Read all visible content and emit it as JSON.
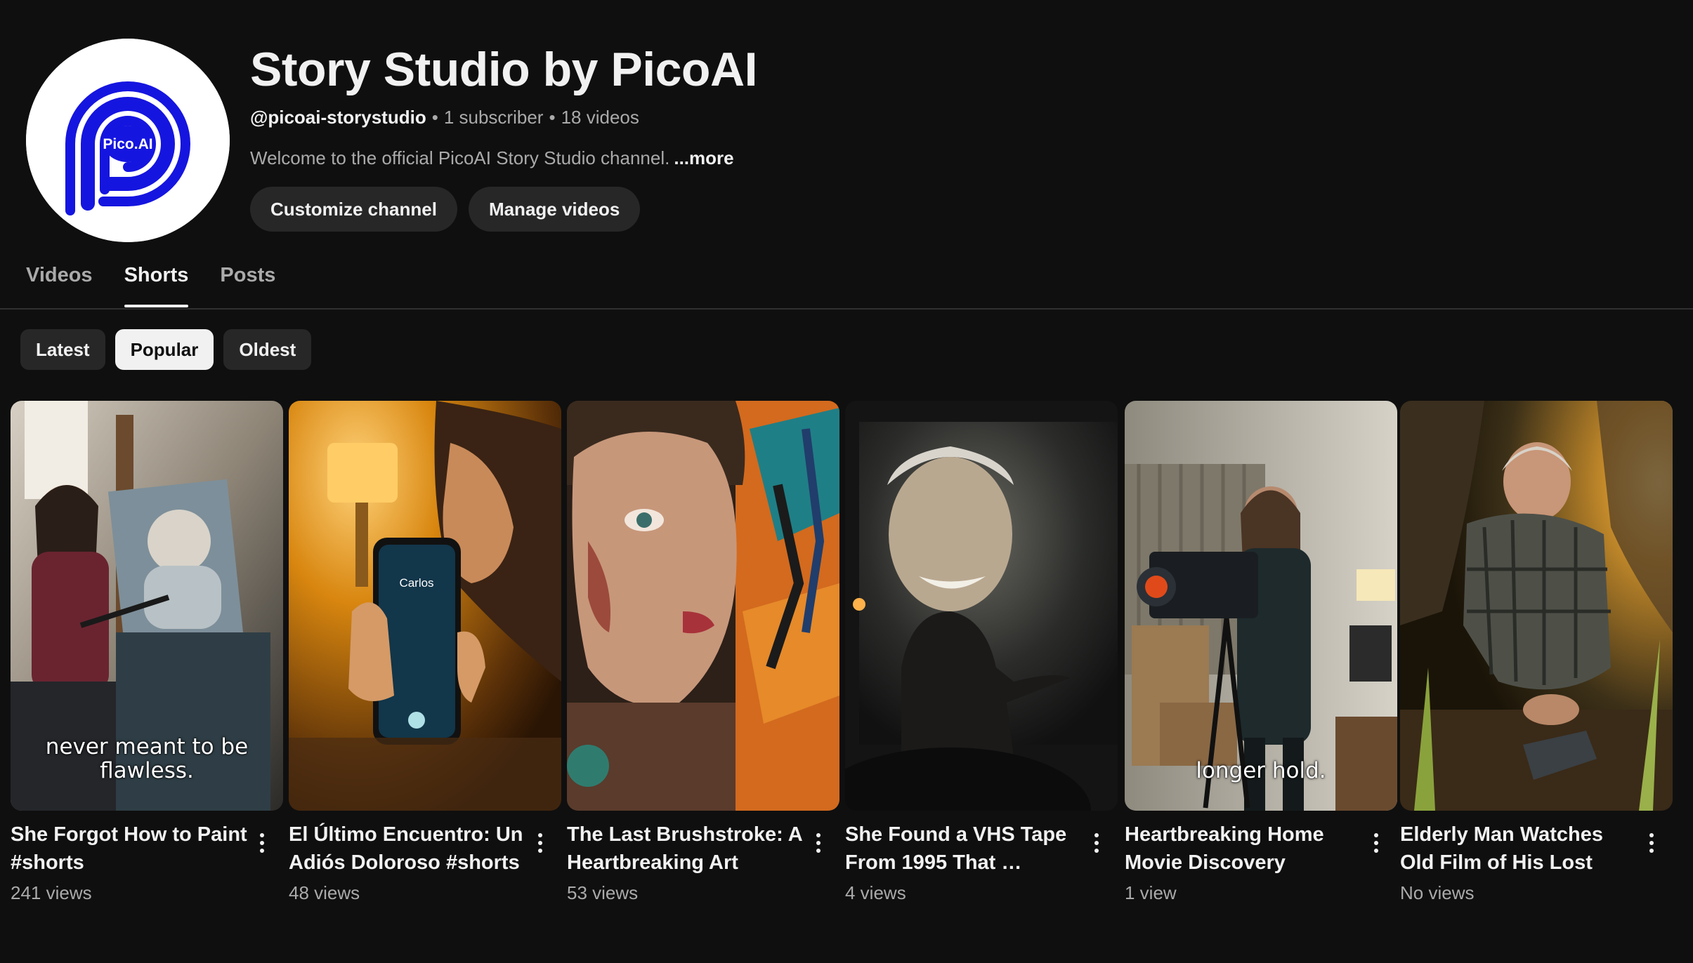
{
  "channel": {
    "avatar_text": "Pico.AI",
    "name": "Story Studio by PicoAI",
    "handle": "@picoai-storystudio",
    "subscribers": "1 subscriber",
    "video_count": "18 videos",
    "description": "Welcome to the official PicoAI Story Studio channel.",
    "more_label": "...more",
    "customize_label": "Customize channel",
    "manage_label": "Manage videos",
    "brand_color": "#1515e0"
  },
  "tabs": [
    {
      "label": "Videos",
      "active": false
    },
    {
      "label": "Shorts",
      "active": true
    },
    {
      "label": "Posts",
      "active": false
    }
  ],
  "sort_chips": [
    {
      "label": "Latest",
      "selected": false
    },
    {
      "label": "Popular",
      "selected": true
    },
    {
      "label": "Oldest",
      "selected": false
    }
  ],
  "shorts": [
    {
      "title": "She Forgot How to Paint #shorts",
      "views": "241 views",
      "caption": "never meant to be flawless."
    },
    {
      "title": "El Último Encuentro: Un Adiós Doloroso #shorts",
      "views": "48 views",
      "caption": "",
      "phone_name": "Carlos"
    },
    {
      "title": "The Last Brushstroke: A Heartbreaking Art Shor…",
      "views": "53 views",
      "caption": ""
    },
    {
      "title": "She Found a VHS Tape From 1995 That …",
      "views": "4 views",
      "caption": ""
    },
    {
      "title": "Heartbreaking Home Movie Discovery #shorts",
      "views": "1 view",
      "caption": "longer hold."
    },
    {
      "title": "Elderly Man Watches Old Film of His Lost Love –…",
      "views": "No views",
      "caption": ""
    }
  ],
  "icons": {
    "more": "kebab-vertical-icon"
  }
}
